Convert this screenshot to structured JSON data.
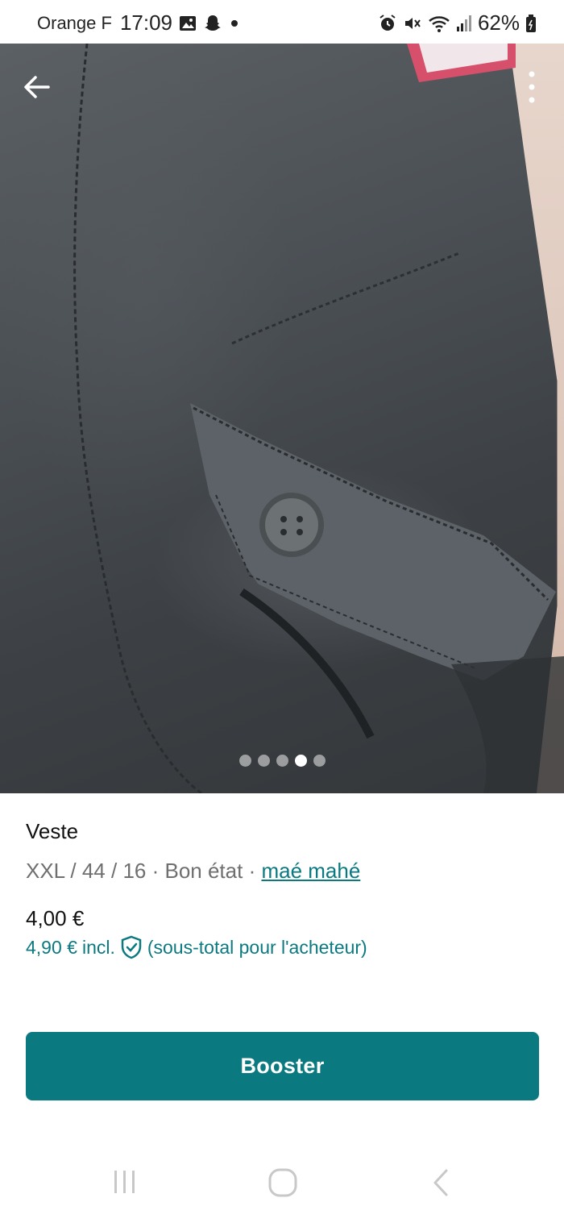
{
  "status_bar": {
    "carrier": "Orange F",
    "time": "17:09",
    "battery": "62%",
    "icons": [
      "gallery-icon",
      "snapchat-icon",
      "notification-dot-icon",
      "alarm-icon",
      "mute-icon",
      "wifi-icon",
      "signal-icon",
      "battery-icon"
    ]
  },
  "gallery": {
    "image_count": 5,
    "active_index": 3
  },
  "item": {
    "title": "Veste",
    "size": "XXL / 44 / 16",
    "separator1": " · ",
    "condition": "Bon état",
    "separator2": " · ",
    "brand": "maé mahé",
    "price": "4,00 €",
    "buyer_price": "4,90 €",
    "incl_label": "incl.",
    "buyer_note": "(sous-total pour l'acheteur)"
  },
  "actions": {
    "booster_label": "Booster"
  },
  "colors": {
    "accent": "#0a7a80",
    "link": "#0b7a80",
    "secondary_text": "#6f6f6f"
  },
  "nav": {
    "icons": [
      "recent-apps-icon",
      "home-icon",
      "back-nav-icon"
    ]
  }
}
